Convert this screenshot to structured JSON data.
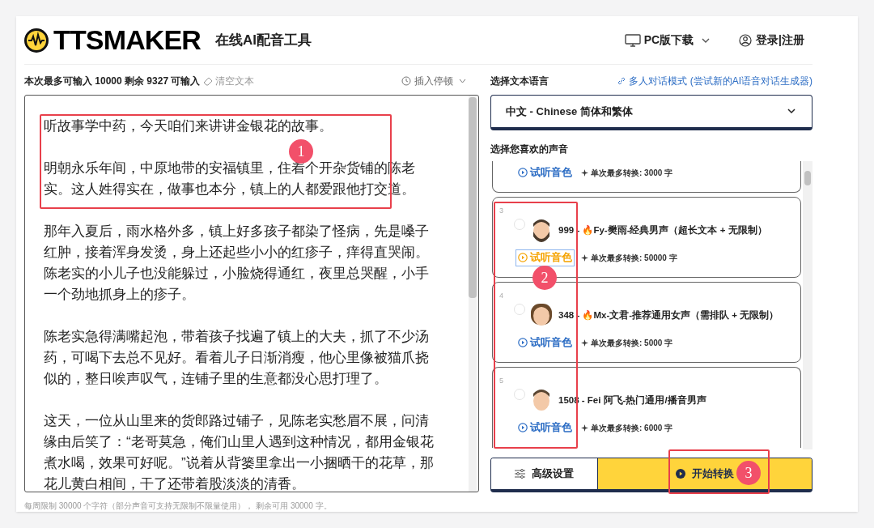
{
  "header": {
    "logo": "TTSMAKER",
    "subtitle": "在线AI配音工具",
    "download": "PC版下载",
    "login": "登录|注册"
  },
  "editor": {
    "limit_label": "本次最多可输入 10000 剩余 9327 可输入",
    "clear": "清空文本",
    "pause": "插入停顿",
    "paragraphs": [
      "听故事学中药，今天咱们来讲讲金银花的故事。",
      "明朝永乐年间，中原地带的安福镇里，住着个开杂货铺的陈老实。这人姓得实在，做事也本分，镇上的人都爱跟他打交道。",
      "那年入夏后，雨水格外多，镇上好多孩子都染了怪病，先是嗓子红肿，接着浑身发烫，身上还起些小小的红疹子，痒得直哭闹。陈老实的小儿子也没能躲过，小脸烧得通红，夜里总哭醒，小手一个劲地抓身上的疹子。",
      "陈老实急得满嘴起泡，带着孩子找遍了镇上的大夫，抓了不少汤药，可喝下去总不见好。看着儿子日渐消瘦，他心里像被猫爪挠似的，整日唉声叹气，连铺子里的生意都没心思打理了。",
      "这天，一位从山里来的货郎路过铺子，见陈老实愁眉不展，问清缘由后笑了：“老哥莫急，俺们山里人遇到这种情况，都用金银花煮水喝，效果可好呢。”说着从背篓里拿出一小捆晒干的花草，那花儿黄白相间，干了还带着股淡淡的清香。"
    ],
    "footer": "每周限制 30000 个字符（部分声音可支持无限制不限量使用）， 剩余可用 30000 字。"
  },
  "language": {
    "label": "选择文本语言",
    "dialog_link": "多人对话模式 (尝试新的AI语音对话生成器)",
    "value": "中文 - Chinese 简体和繁体"
  },
  "voices": {
    "label": "选择您喜欢的声音",
    "items": [
      {
        "preview": "试听音色",
        "limit": "单次最多转换: 3000 字",
        "focused": false
      },
      {
        "number": "3",
        "name": "999 - 🔥Fy-樊雨-经典男声（超长文本 + 无限制）",
        "kind": "bearded",
        "selected": false,
        "preview": "试听音色",
        "limit": "单次最多转换: 50000 字",
        "focused": true
      },
      {
        "number": "4",
        "name": "348 - 🔥Mx-文君-推荐通用女声（需排队 + 无限制）",
        "kind": "curly",
        "selected": false,
        "preview": "试听音色",
        "limit": "单次最多转换: 5000 字",
        "focused": false
      },
      {
        "number": "5",
        "name": "1508 - Fei 阿飞-热门通用/播音男声",
        "kind": "short",
        "selected": false,
        "preview": "试听音色",
        "limit": "单次最多转换: 6000 字",
        "focused": false
      }
    ]
  },
  "actions": {
    "settings": "高级设置",
    "start": "开始转换"
  },
  "annotations": [
    "1",
    "2",
    "3"
  ]
}
